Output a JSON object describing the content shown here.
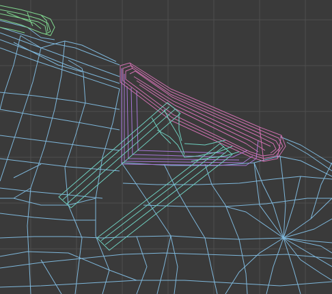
{
  "viewport": {
    "kind": "3d-wireframe-viewport",
    "background_color": "#3a3a3a",
    "grid_color": "#4e4e4e",
    "objects": [
      {
        "name": "body-mesh",
        "wire_color": "#7fb8dc"
      },
      {
        "name": "mirror-mesh",
        "wire_color": "#d070b0"
      },
      {
        "name": "bracket-mesh",
        "wire_color": "#a878d8"
      },
      {
        "name": "rod-mesh",
        "wire_color": "#6fd0c0"
      },
      {
        "name": "corner-mesh",
        "wire_color": "#80d890"
      }
    ]
  }
}
